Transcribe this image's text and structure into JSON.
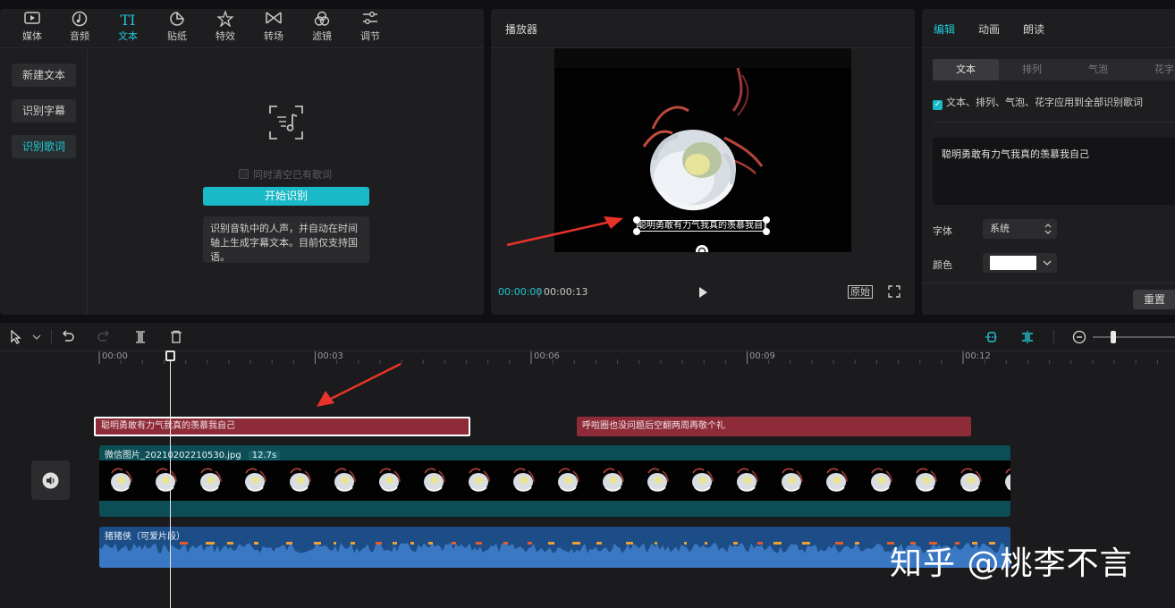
{
  "toolbar": {
    "tabs": [
      {
        "label": "媒体",
        "icon": "media-icon"
      },
      {
        "label": "音频",
        "icon": "audio-icon"
      },
      {
        "label": "文本",
        "icon": "text-icon"
      },
      {
        "label": "贴纸",
        "icon": "sticker-icon"
      },
      {
        "label": "特效",
        "icon": "effects-icon"
      },
      {
        "label": "转场",
        "icon": "transition-icon"
      },
      {
        "label": "滤镜",
        "icon": "filter-icon"
      },
      {
        "label": "调节",
        "icon": "adjust-icon"
      }
    ],
    "active": "文本",
    "text_glyph": "TI"
  },
  "sidebar": {
    "items": [
      {
        "label": "新建文本"
      },
      {
        "label": "识别字幕"
      },
      {
        "label": "识别歌词"
      }
    ],
    "active": "识别歌词"
  },
  "lyrics": {
    "clear_checkbox_label": "同时清空已有歌词",
    "start_button": "开始识别",
    "info_text": "识别音轨中的人声，并自动在时间轴上生成字幕文本。目前仅支持国语。"
  },
  "player": {
    "title": "播放器",
    "subtitle_text": "聪明勇敢有力气我真的羡慕我自己",
    "time_current": "00:00:00",
    "time_separator": "|",
    "time_total": "00:00:13",
    "original_button": "原始"
  },
  "right_panel": {
    "tabs": [
      "编辑",
      "动画",
      "朗读"
    ],
    "active_tab": "编辑",
    "segments": [
      "文本",
      "排列",
      "气泡",
      "花字"
    ],
    "active_segment": "文本",
    "apply_all_label": "文本、排列、气泡、花字应用到全部识别歌词",
    "apply_all_checked": true,
    "text_value": "聪明勇敢有力气我真的羡慕我自己",
    "font_label": "字体",
    "font_value": "系统",
    "color_label": "颜色",
    "color_value": "#ffffff",
    "reset_button": "重置"
  },
  "timeline": {
    "ruler_labels": [
      "00:00",
      "00:03",
      "00:06",
      "00:09",
      "00:12"
    ],
    "subtitle_clips": [
      {
        "text": "聪明勇敢有力气我真的羡慕我自己",
        "selected": true
      },
      {
        "text": "呼啦圈也没问题后空翻两周再敬个礼",
        "selected": false
      }
    ],
    "video_clip": {
      "name": "微信图片_20210202210530.jpg",
      "duration": "12.7s"
    },
    "audio_clip": {
      "name": "猪猪侠（可爱片段）"
    }
  },
  "watermark": "知乎 @桃李不言",
  "colors": {
    "accent": "#1ec8d4",
    "subtitle_clip": "#8e2b38",
    "video_clip": "#0d4d55",
    "audio_clip": "#1c4d86"
  }
}
